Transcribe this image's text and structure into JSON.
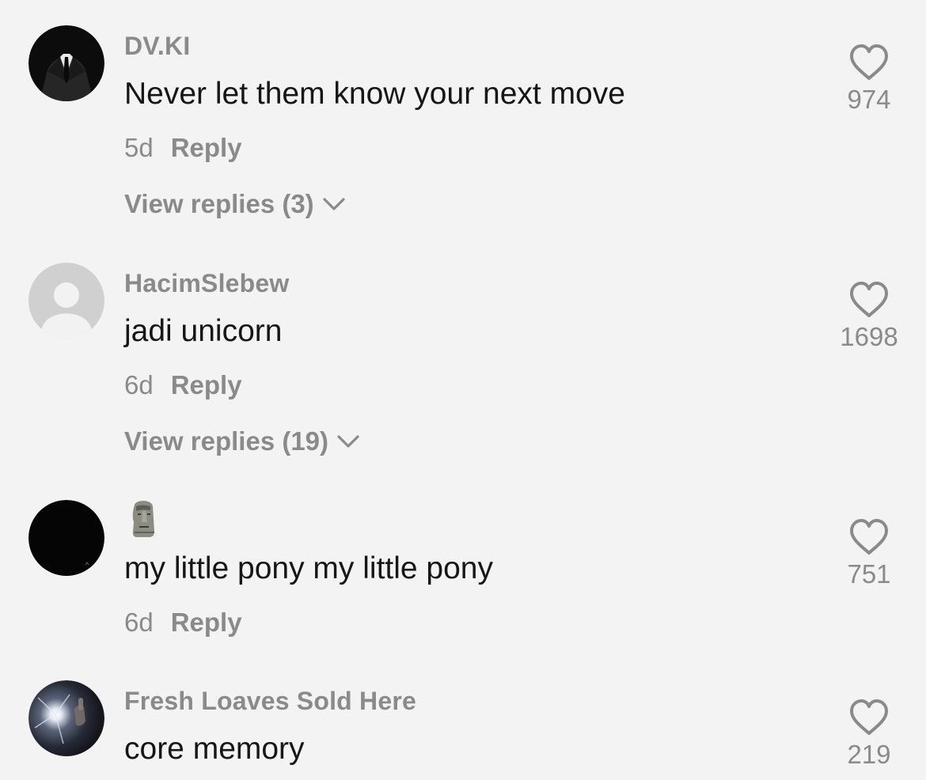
{
  "comments": [
    {
      "avatar_icon": "suit-man-avatar",
      "username": "DV.KI",
      "text": "Never let them know your next move",
      "age": "5d",
      "reply_label": "Reply",
      "view_replies": "View replies (3)",
      "likes": "974"
    },
    {
      "avatar_icon": "default-user-avatar",
      "username": "HacimSlebew",
      "text": "jadi unicorn",
      "age": "6d",
      "reply_label": "Reply",
      "view_replies": "View replies (19)",
      "likes": "1698"
    },
    {
      "avatar_icon": "black-avatar",
      "username": "",
      "username_icon": "moai-emoji-icon",
      "text": "my little pony my little pony",
      "age": "6d",
      "reply_label": "Reply",
      "likes": "751"
    },
    {
      "avatar_icon": "light-flare-avatar",
      "username": "Fresh Loaves Sold Here",
      "text": "core memory",
      "likes": "219"
    }
  ],
  "colors": {
    "background": "#f3f3f3",
    "primary_text": "#161616",
    "secondary_text": "#8a8a8a"
  }
}
